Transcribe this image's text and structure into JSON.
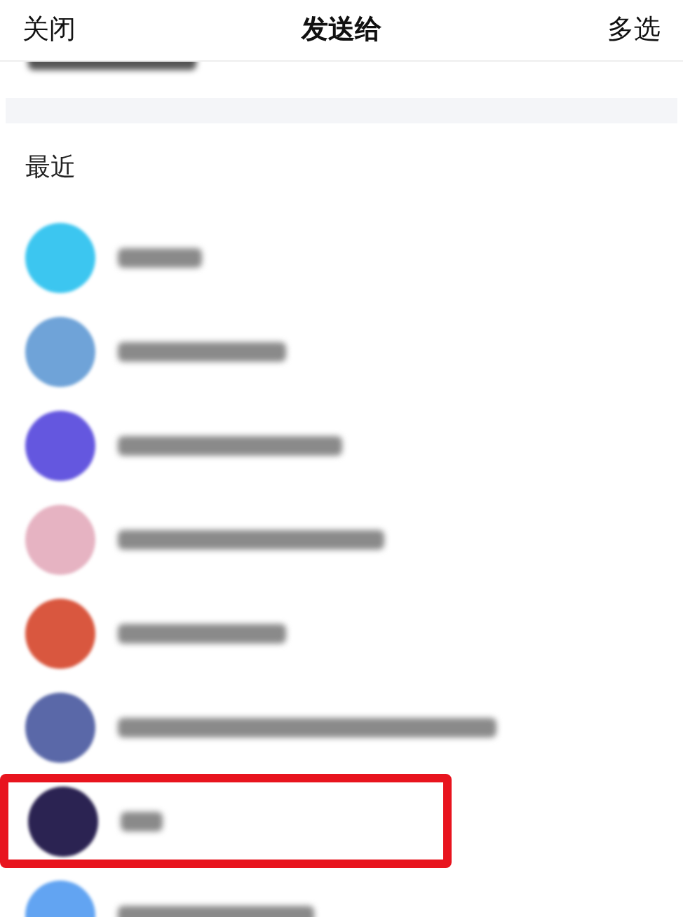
{
  "nav": {
    "left": "关闭",
    "title": "发送给",
    "right": "多选"
  },
  "section_title": "最近",
  "contacts": [
    {
      "color": "#3cc6f0",
      "highlighted": false
    },
    {
      "color": "#6fa3d8",
      "highlighted": false
    },
    {
      "color": "#6457df",
      "highlighted": false
    },
    {
      "color": "#e6b3c2",
      "highlighted": false
    },
    {
      "color": "#d9573f",
      "highlighted": false
    },
    {
      "color": "#5a68a8",
      "highlighted": false
    },
    {
      "color": "#2b2352",
      "highlighted": true
    },
    {
      "color": "#62a4f2",
      "highlighted": false
    }
  ]
}
